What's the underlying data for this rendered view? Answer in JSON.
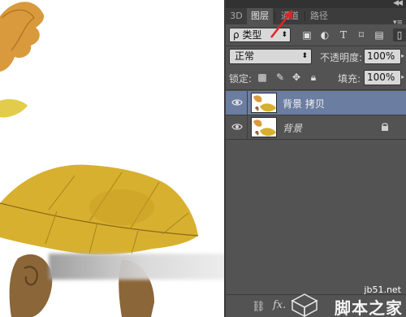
{
  "panel": {
    "tabs": [
      {
        "label": "3D",
        "active": false
      },
      {
        "label": "图层",
        "active": true
      },
      {
        "label": "通道",
        "active": false
      },
      {
        "label": "路径",
        "active": false
      }
    ],
    "filter": {
      "kind_label": "ρ 类型"
    },
    "blend_mode": "正常",
    "opacity_label": "不透明度:",
    "opacity_value": "100%",
    "lock_label": "锁定:",
    "fill_label": "填充:",
    "fill_value": "100%",
    "layers": [
      {
        "name": "背景 拷贝",
        "selected": true,
        "visible": true,
        "locked": false
      },
      {
        "name": "背景",
        "selected": false,
        "visible": true,
        "locked": true
      }
    ],
    "bottom_icons": [
      "link-icon",
      "fx-icon"
    ]
  },
  "watermark": {
    "url": "jb51.net",
    "text": "脚本之家"
  },
  "colors": {
    "panel_bg": "#535353",
    "tab_bar": "#3c3c3c",
    "selected_layer": "#6b7ea1",
    "annotation_arrow": "#e02424"
  }
}
